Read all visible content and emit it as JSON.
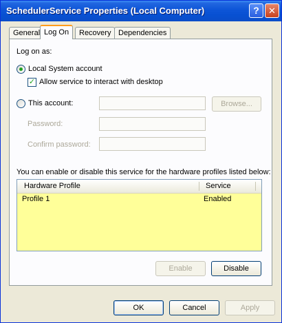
{
  "window": {
    "title": "SchedulerService Properties (Local Computer)"
  },
  "tabs": [
    {
      "label": "General"
    },
    {
      "label": "Log On"
    },
    {
      "label": "Recovery"
    },
    {
      "label": "Dependencies"
    }
  ],
  "logon": {
    "heading": "Log on as:",
    "local_system_label": "Local System account",
    "interact_label": "Allow service to interact with desktop",
    "this_account_label": "This account:",
    "browse_label": "Browse...",
    "password_label": "Password:",
    "confirm_label": "Confirm password:",
    "account_value": "",
    "password_value": "",
    "confirm_value": ""
  },
  "profiles": {
    "description": "You can enable or disable this service for the hardware profiles listed below:",
    "columns": [
      "Hardware Profile",
      "Service"
    ],
    "rows": [
      {
        "profile": "Profile 1",
        "service": "Enabled"
      }
    ],
    "enable_label": "Enable",
    "disable_label": "Disable",
    "list_bg": "#ffff99"
  },
  "footer": {
    "ok": "OK",
    "cancel": "Cancel",
    "apply": "Apply"
  },
  "colors": {
    "titlebar": "#0a4dc8",
    "tab_accent": "#ff9c1a",
    "radio_dot": "#21a121"
  }
}
